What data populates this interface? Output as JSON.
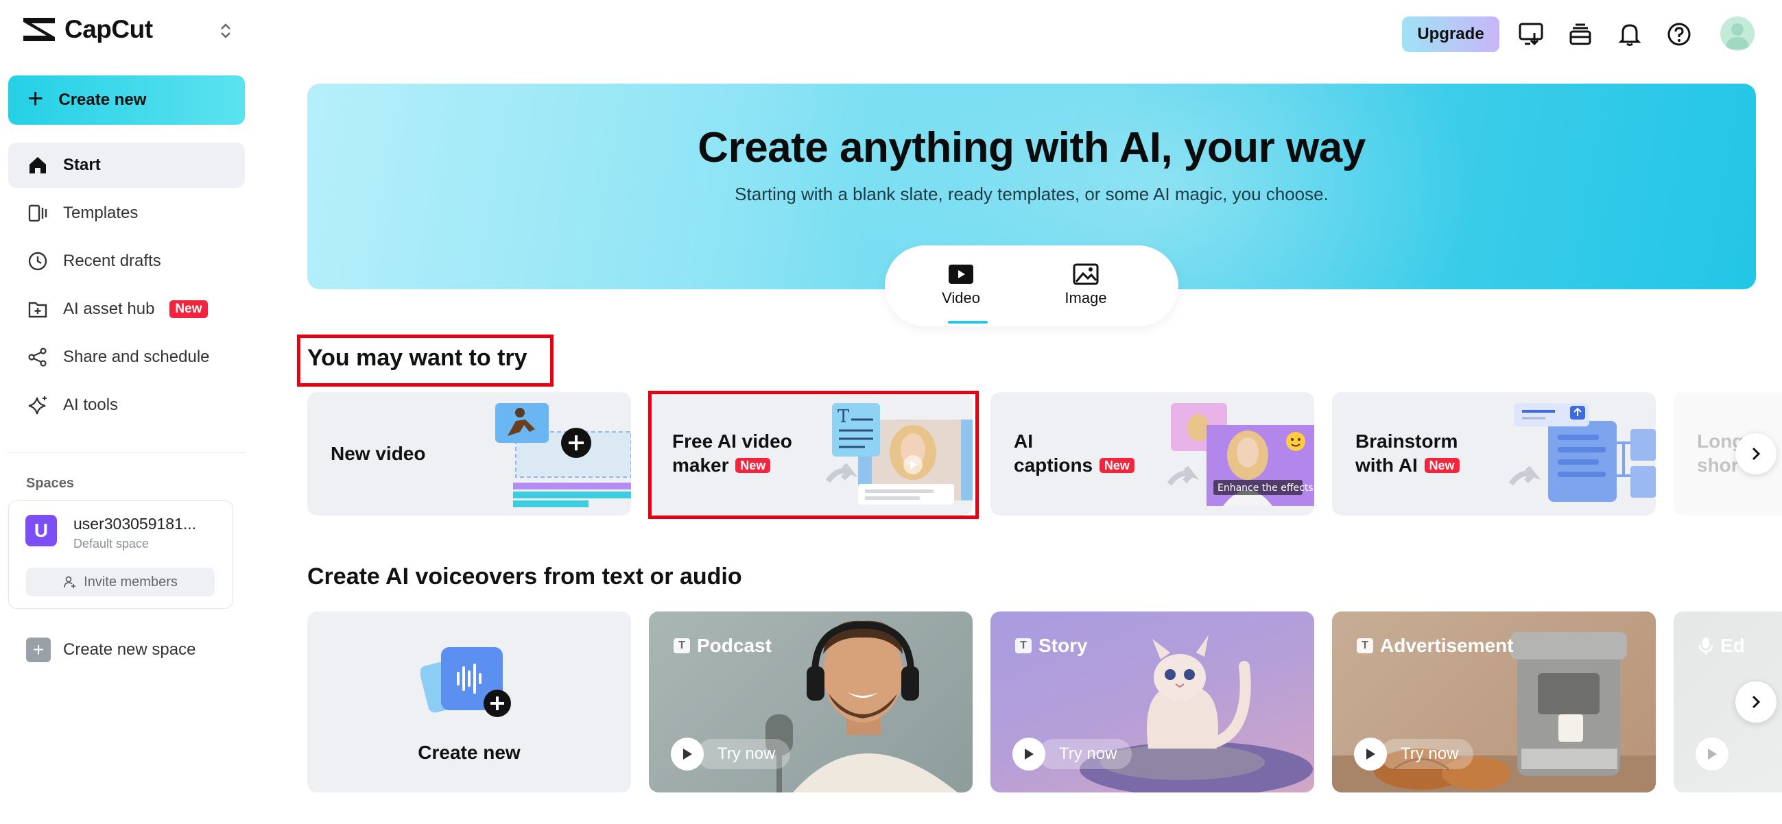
{
  "brand": {
    "name": "CapCut"
  },
  "sidebar": {
    "create_label": "Create new",
    "items": [
      {
        "label": "Start",
        "icon": "home-icon"
      },
      {
        "label": "Templates",
        "icon": "templates-icon"
      },
      {
        "label": "Recent drafts",
        "icon": "clock-icon"
      },
      {
        "label": "AI asset hub",
        "icon": "folder-icon",
        "badge": "New"
      },
      {
        "label": "Share and schedule",
        "icon": "share-icon"
      },
      {
        "label": "AI tools",
        "icon": "sparkle-icon"
      }
    ],
    "spaces_title": "Spaces",
    "space": {
      "initial": "U",
      "name": "user303059181...",
      "sub": "Default space",
      "invite_label": "Invite members"
    },
    "new_space_label": "Create new space"
  },
  "topbar": {
    "upgrade_label": "Upgrade"
  },
  "hero": {
    "title": "Create anything with AI, your way",
    "subtitle": "Starting with a blank slate, ready templates, or some AI magic, you choose.",
    "tabs": [
      {
        "label": "Video"
      },
      {
        "label": "Image"
      }
    ]
  },
  "try_section": {
    "title": "You may want to try",
    "cards": [
      {
        "line1": "New video",
        "line2": ""
      },
      {
        "line1": "Free AI video",
        "line2": "maker",
        "badge": "New"
      },
      {
        "line1": "AI",
        "line2": "captions",
        "badge": "New",
        "overlay": "Enhance the effects"
      },
      {
        "line1": "Brainstorm",
        "line2": "with AI",
        "badge": "New"
      },
      {
        "line1": "Long",
        "line2": "shor"
      }
    ]
  },
  "voice_section": {
    "title": "Create AI voiceovers from text or audio",
    "create_label": "Create new",
    "try_label": "Try now",
    "cards": [
      {
        "label": "Podcast"
      },
      {
        "label": "Story"
      },
      {
        "label": "Advertisement"
      },
      {
        "label": "Ed"
      }
    ]
  },
  "colors": {
    "accent": "#23c6e6",
    "new_badge": "#f4243c",
    "highlight": "#e60012"
  }
}
